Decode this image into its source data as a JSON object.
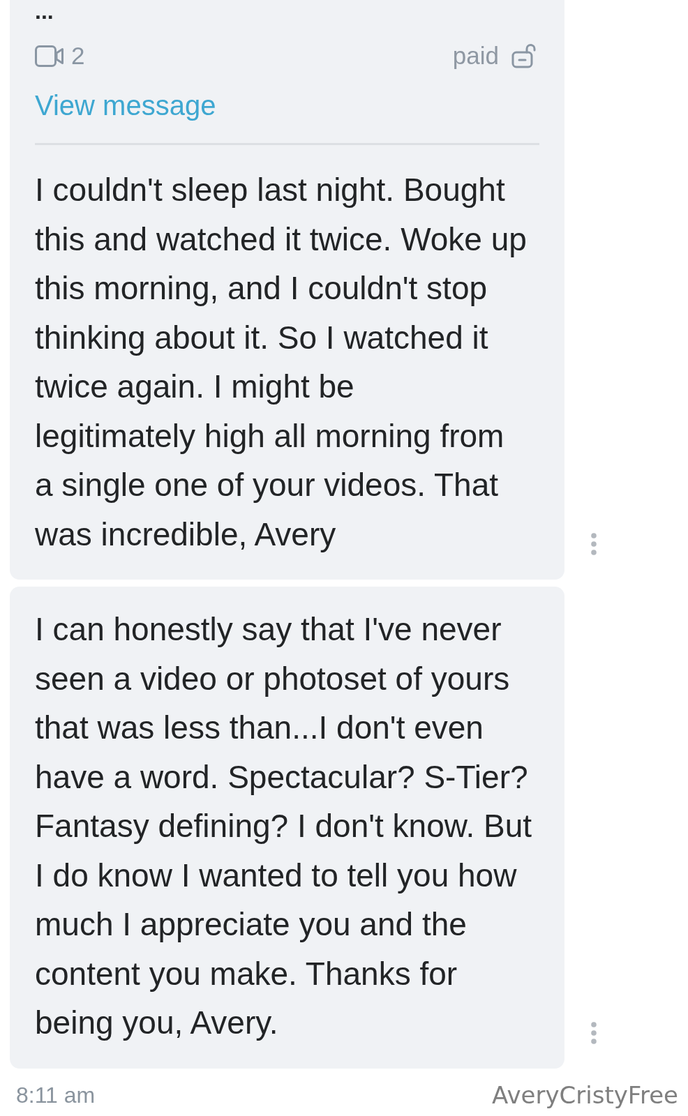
{
  "messages": [
    {
      "truncated_text": "...",
      "media": {
        "kind": "video",
        "count": "2",
        "price_label": "paid",
        "unlocked": true
      },
      "link": "View message",
      "lines": [
        "I couldn't sleep last night. Bought",
        "this and watched it twice. Woke up",
        "this morning, and I couldn't stop",
        "thinking about it. So I watched it",
        "twice again. I might be",
        "legitimately high all morning from",
        "a single one of your videos. That",
        "was incredible, Avery"
      ]
    },
    {
      "lines": [
        "I can honestly say that I've never",
        "seen a video or photoset of yours",
        "that was less than...I don't even",
        "have a word. Spectacular? S-Tier?",
        "Fantasy defining? I don't know. But",
        "I do know I wanted to tell you how",
        "much I appreciate you and the",
        "content you make. Thanks for",
        "being you, Avery."
      ]
    }
  ],
  "footer": {
    "time": "8:11 am",
    "name": "AveryCristyFree"
  }
}
